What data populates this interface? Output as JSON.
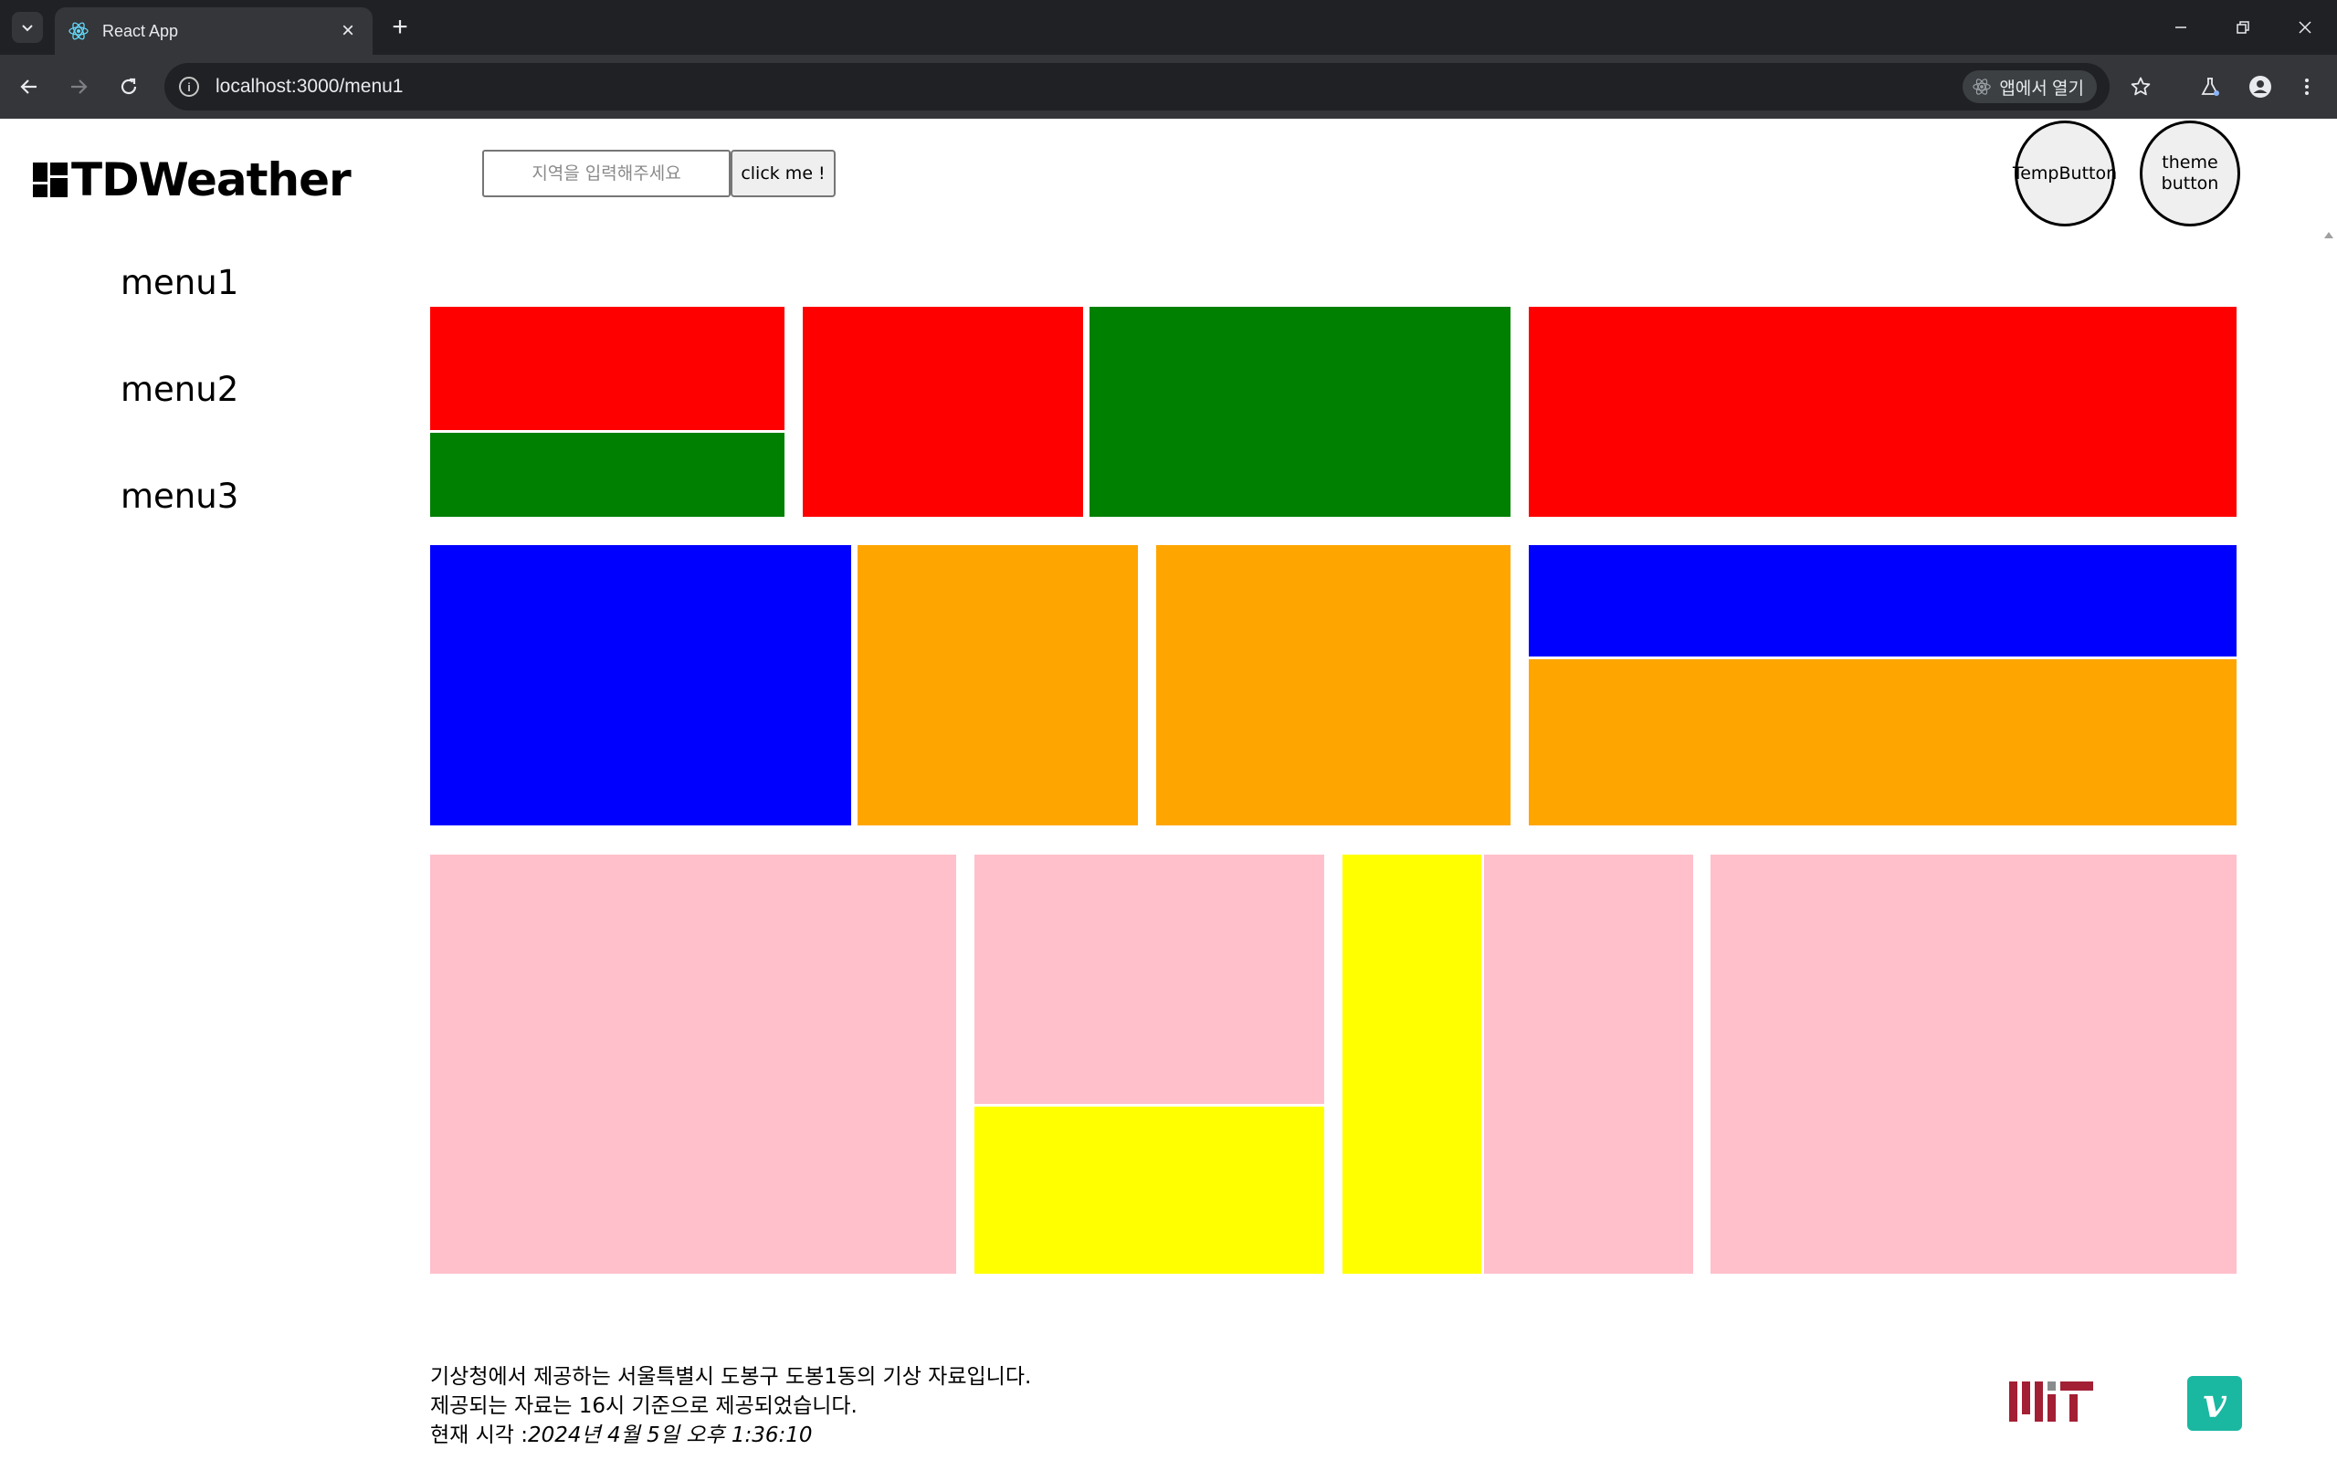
{
  "browser": {
    "tab_title": "React App",
    "url": "localhost:3000/menu1",
    "open_in_app_label": "앱에서 열기",
    "window_controls": [
      "minimize-icon",
      "restore-icon",
      "close-icon"
    ]
  },
  "header": {
    "logo_text": "TDWeather",
    "search_placeholder": "지역을 입력해주세요",
    "search_value": "",
    "submit_label": "click me !",
    "temp_button_label": "TempButton",
    "theme_button_label": "theme button"
  },
  "sidebar": {
    "items": [
      {
        "label": "menu1"
      },
      {
        "label": "menu2"
      },
      {
        "label": "menu3"
      }
    ]
  },
  "grid": {
    "colors": {
      "red": "#ff0000",
      "green": "#008000",
      "blue": "#0000ff",
      "orange": "#ffa500",
      "pink": "#ffc0cb",
      "yellow": "#ffff00"
    },
    "rows": [
      [
        "red",
        "green",
        "red",
        "green",
        "red"
      ],
      [
        "blue",
        "orange",
        "orange",
        "blue",
        "orange"
      ],
      [
        "pink",
        "pink",
        "yellow",
        "yellow",
        "pink",
        "pink"
      ]
    ]
  },
  "footer": {
    "line1": "기상청에서 제공하는 서울특별시 도봉구 도봉1동의 기상 자료입니다.",
    "line2": "제공되는 자료는 16시 기준으로 제공되었습니다.",
    "line3_prefix": "현재 시각 :",
    "line3_time": "2024년 4월 5일 오후 1:36:10"
  }
}
